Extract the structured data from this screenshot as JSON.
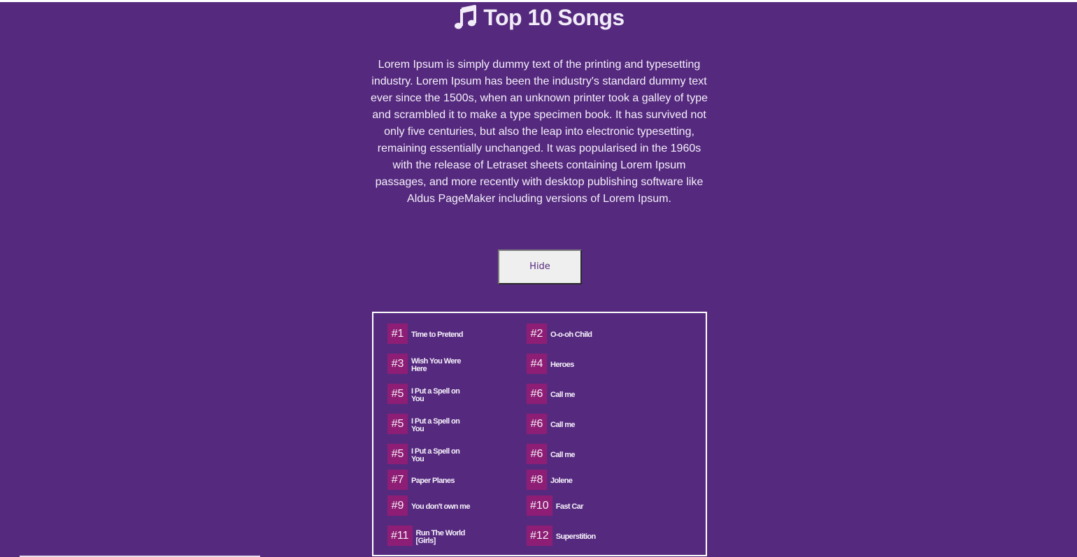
{
  "header": {
    "title": "Top 10 Songs",
    "icon": "music-note-icon"
  },
  "intro": {
    "text": "Lorem Ipsum is simply dummy text of the printing and typesetting industry. Lorem Ipsum has been the industry's standard dummy text ever since the 1500s, when an unknown printer took a galley of type and scrambled it to make a type specimen book. It has survived not only five centuries, but also the leap into electronic typesetting, remaining essentially unchanged. It was popularised in the 1960s with the release of Letraset sheets containing Lorem Ipsum passages, and more recently with desktop publishing software like Aldus PageMaker including versions of Lorem Ipsum."
  },
  "toggle_button": {
    "label": "Hide"
  },
  "songs": [
    {
      "rank": "#1",
      "title": "Time to Pretend"
    },
    {
      "rank": "#2",
      "title": "O-o-oh Child"
    },
    {
      "rank": "#3",
      "title": "Wish You Were Here"
    },
    {
      "rank": "#4",
      "title": "Heroes"
    },
    {
      "rank": "#5",
      "title": "I Put a Spell on You"
    },
    {
      "rank": "#6",
      "title": "Call me"
    },
    {
      "rank": "#5",
      "title": "I Put a Spell on You"
    },
    {
      "rank": "#6",
      "title": "Call me"
    },
    {
      "rank": "#5",
      "title": "I Put a Spell on You"
    },
    {
      "rank": "#6",
      "title": "Call me"
    },
    {
      "rank": "#7",
      "title": "Paper Planes"
    },
    {
      "rank": "#8",
      "title": "Jolene"
    },
    {
      "rank": "#9",
      "title": "You don't own me"
    },
    {
      "rank": "#10",
      "title": "Fast Car"
    },
    {
      "rank": "#11",
      "title": "Run The World [Girls]"
    },
    {
      "rank": "#12",
      "title": "Superstition"
    }
  ],
  "colors": {
    "background": "#552a7e",
    "rank_badge": "#8e1e75",
    "button_bg": "#efefef",
    "text": "#f3eef7"
  }
}
